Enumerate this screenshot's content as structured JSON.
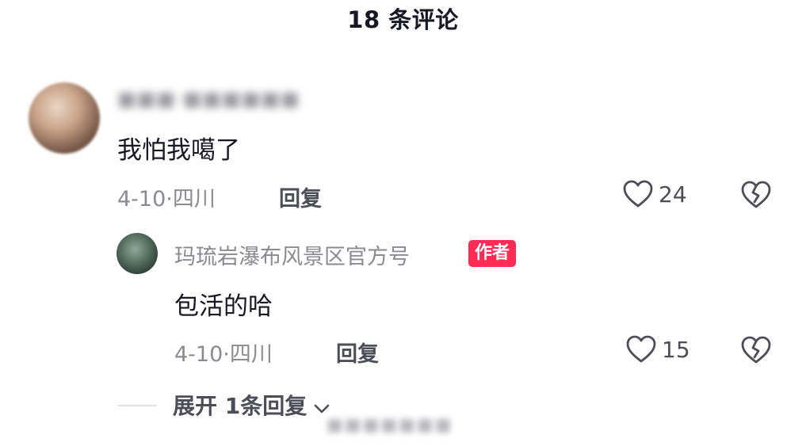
{
  "header": {
    "title": "18 条评论"
  },
  "comment": {
    "username": "■■■·■■■■■■",
    "text": "我怕我噶了",
    "date": "4-10",
    "location": "四川",
    "reply_label": "回复",
    "likes": "24",
    "like_icon": "heart-outline-icon",
    "dislike_icon": "broken-heart-icon"
  },
  "reply": {
    "author": "玛琉岩瀑布风景区官方号",
    "badge": "作者",
    "text": "包活的哈",
    "date": "4-10",
    "location": "四川",
    "reply_label": "回复",
    "likes": "15"
  },
  "expand": {
    "label": "展开 1条回复",
    "icon": "chevron-down-icon"
  },
  "watermark": "■■■■■■■",
  "colors": {
    "accent": "#fe2c55",
    "text": "#161823",
    "muted": "#8a8b91"
  }
}
